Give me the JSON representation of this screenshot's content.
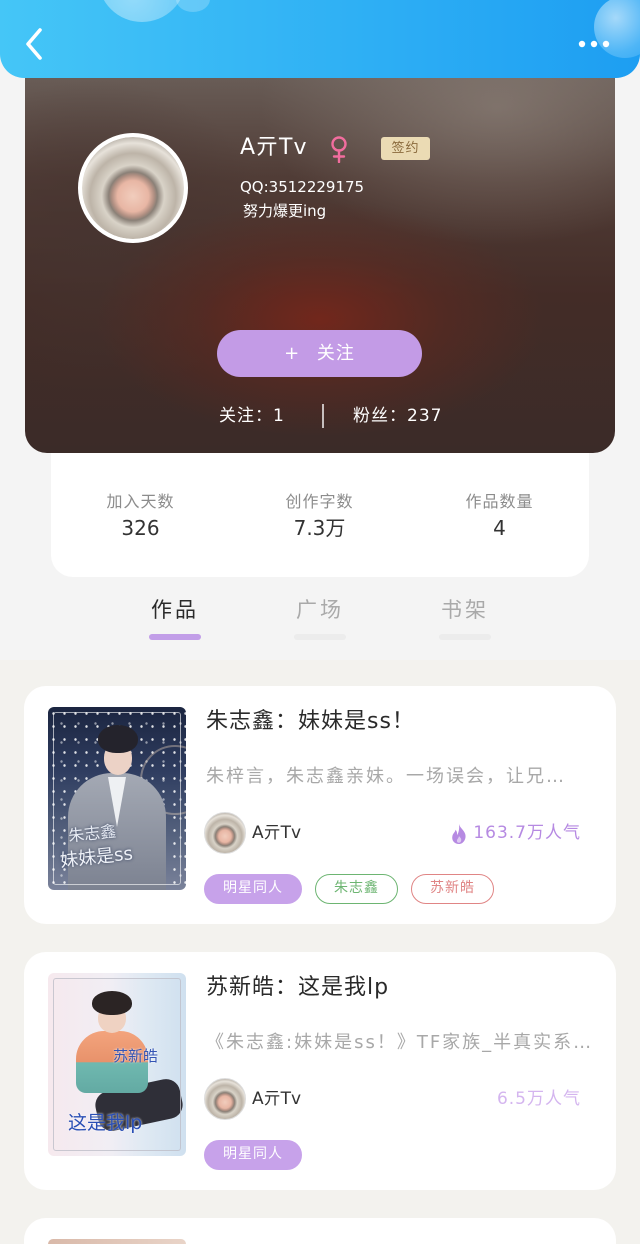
{
  "header": {
    "back_icon": "chevron-left-icon",
    "more_icon": "more-horizontal-icon",
    "gradient_start": "#45c6f7",
    "gradient_end": "#1d9ef2"
  },
  "profile": {
    "name": "A亓Tv",
    "gender_icon": "female-icon",
    "gender_color": "#f26d9e",
    "badge": "签约",
    "qq": "QQ:3512229175",
    "bio": "努力爆更ing",
    "follow_button": "+ 关注",
    "follow_button_color": "#c39be6",
    "following_label": "关注：",
    "following_count": "1",
    "followers_label": "粉丝：",
    "followers_count": "237"
  },
  "stats": [
    {
      "label": "加入天数",
      "value": "326"
    },
    {
      "label": "创作字数",
      "value": "7.3万"
    },
    {
      "label": "作品数量",
      "value": "4"
    }
  ],
  "tabs": [
    {
      "label": "作品",
      "active": true
    },
    {
      "label": "广场",
      "active": false
    },
    {
      "label": "书架",
      "active": false
    }
  ],
  "accent_color": "#c29ee8",
  "works": [
    {
      "title": "朱志鑫：妹妹是ss！",
      "description": "朱梓言，朱志鑫亲妹。一场误会，让兄…",
      "author": "A亓Tv",
      "popularity_icon": "fire-icon",
      "popularity": "163.7万人气",
      "popularity_color": "#b68ae2",
      "cover_lines": [
        "朱志鑫",
        "妹妹是ss"
      ],
      "tags": [
        {
          "label": "明星同人",
          "filled": true,
          "color": "#c7a2ea"
        },
        {
          "label": "朱志鑫",
          "filled": false,
          "color": "#6db572"
        },
        {
          "label": "苏新皓",
          "filled": false,
          "color": "#e08585"
        }
      ]
    },
    {
      "title": "苏新皓：这是我lp",
      "description": "《朱志鑫:妹妹是ss！》TF家族_半真实系…",
      "author": "A亓Tv",
      "popularity": "6.5万人气",
      "popularity_color": "#d4b5ef",
      "cover_lines": [
        "苏新皓",
        "这是我lp"
      ],
      "tags": [
        {
          "label": "明星同人",
          "filled": true,
          "color": "#c7a2ea"
        }
      ]
    }
  ]
}
